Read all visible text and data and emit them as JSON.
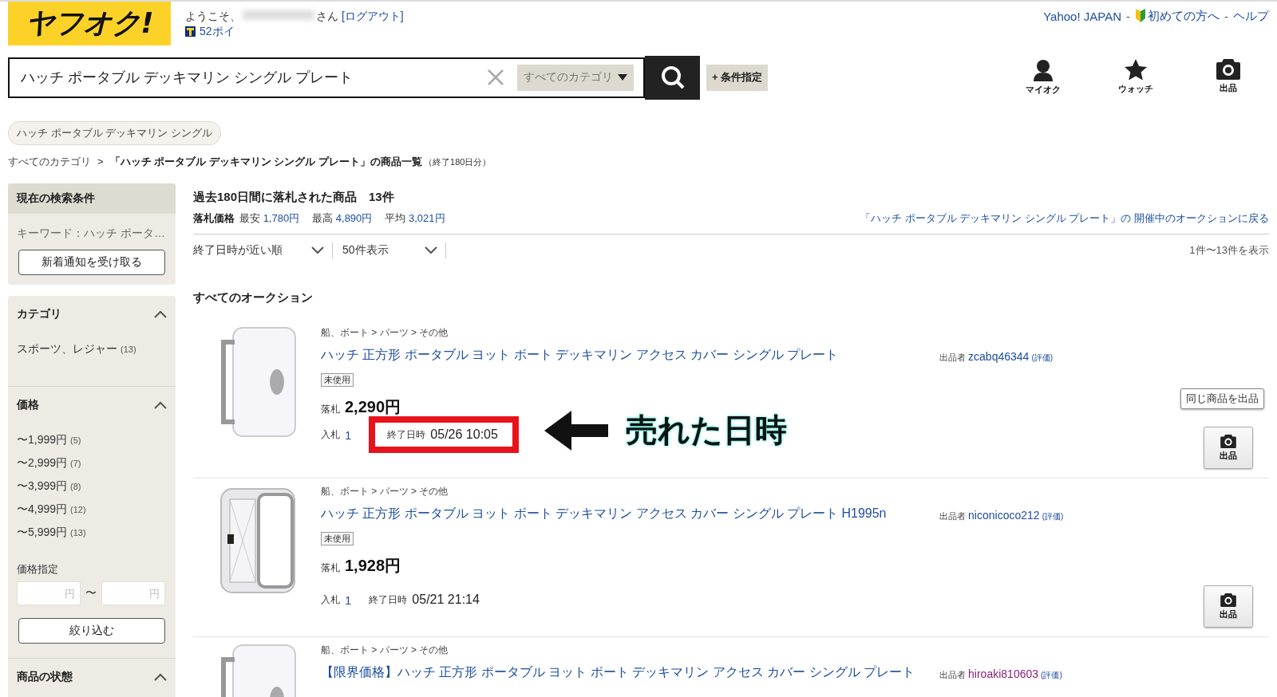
{
  "header": {
    "logo": "ヤフオク!",
    "welcome": "ようこそ、",
    "welcome_suffix": "さん",
    "logout": "[ログアウト]",
    "points": "52ポイ",
    "top_links": [
      {
        "kind": "link",
        "label": "Yahoo! JAPAN"
      },
      {
        "kind": "sep",
        "label": "-"
      },
      {
        "kind": "beginner",
        "label": "初めての方へ"
      },
      {
        "kind": "sep",
        "label": "-"
      },
      {
        "kind": "link",
        "label": "ヘルプ"
      }
    ],
    "search": {
      "value": "ハッチ ポータブル デッキマリン シングル プレート",
      "category": "すべてのカテゴリ",
      "conditions": "+ 条件指定"
    },
    "nav": [
      {
        "kind": "person",
        "label": "マイオク"
      },
      {
        "kind": "star",
        "label": "ウォッチ"
      },
      {
        "kind": "camera",
        "label": "出品"
      }
    ]
  },
  "keyword_chip": "ハッチ ポータブル デッキマリン シングル",
  "breadcrumb": {
    "root": "すべてのカテゴリ",
    "sep": ">",
    "title": "「ハッチ ポータブル デッキマリン シングル プレート」の商品一覧",
    "note": "（終了180日分）"
  },
  "sidebar": {
    "current": {
      "title": "現在の検索条件",
      "keyword": "キーワード：ハッチ ポータ…",
      "button": "新着通知を受け取る"
    },
    "category": {
      "title": "カテゴリ",
      "expanded": true,
      "items": [
        {
          "label": "スポーツ、レジャー",
          "count": "(13)"
        }
      ]
    },
    "price": {
      "title": "価格",
      "expanded": true,
      "items": [
        {
          "label": "〜1,999円",
          "count": "(5)"
        },
        {
          "label": "〜2,999円",
          "count": "(7)"
        },
        {
          "label": "〜3,999円",
          "count": "(8)"
        },
        {
          "label": "〜4,999円",
          "count": "(12)"
        },
        {
          "label": "〜5,999円",
          "count": "(13)"
        }
      ],
      "range_label": "価格指定",
      "min_placeholder": "円",
      "tilde": "〜",
      "max_placeholder": "円",
      "button": "絞り込む"
    },
    "condition": {
      "title": "商品の状態",
      "expanded": true
    }
  },
  "results": {
    "heading": "過去180日間に落札された商品　13件",
    "summary_label": "落札価格",
    "stats": [
      {
        "label": "最安",
        "value": "1,780円"
      },
      {
        "label": "最高",
        "value": "4,890円"
      },
      {
        "label": "平均",
        "value": "3,021円"
      }
    ],
    "back_link": "「ハッチ ポータブル デッキマリン シングル プレート」の 開催中のオークションに戻る",
    "sort": "終了日時が近い順",
    "per_page": "50件表示",
    "count": "1件〜13件を表示",
    "section_title": "すべてのオークション",
    "items": [
      {
        "path": "船、ボート > パーツ > その他",
        "title": "ハッチ 正方形 ポータブル ヨット ボート デッキマリン アクセス カバー シングル プレート",
        "condition": "未使用",
        "price_label": "落札",
        "price": "2,290円",
        "bids_label": "入札",
        "bids": "1",
        "end_label": "終了日時",
        "end": "05/26 10:05",
        "highlighted": true,
        "seller_label": "出品者",
        "seller": "zcabq46344",
        "seller_visited": false,
        "rating": "(評価)",
        "tooltip": "同じ商品を出品",
        "sell_button": "出品"
      },
      {
        "path": "船、ボート > パーツ > その他",
        "title": "ハッチ 正方形 ポータブル ヨット ボート デッキマリン アクセス カバー シングル プレート H1995n",
        "condition": "未使用",
        "price_label": "落札",
        "price": "1,928円",
        "bids_label": "入札",
        "bids": "1",
        "end_label": "終了日時",
        "end": "05/21 21:14",
        "highlighted": false,
        "seller_label": "出品者",
        "seller": "niconicoco212",
        "seller_visited": false,
        "rating": "(評価)",
        "sell_button": "出品"
      },
      {
        "path": "船、ボート > パーツ > その他",
        "title": "【限界価格】ハッチ 正方形 ポータブル ヨット ボート デッキマリン アクセス カバー シングル プレート",
        "seller_label": "出品者",
        "seller": "hiroaki810603",
        "seller_visited": true,
        "rating": "(評価)"
      }
    ]
  },
  "annotation": "売れた日時"
}
